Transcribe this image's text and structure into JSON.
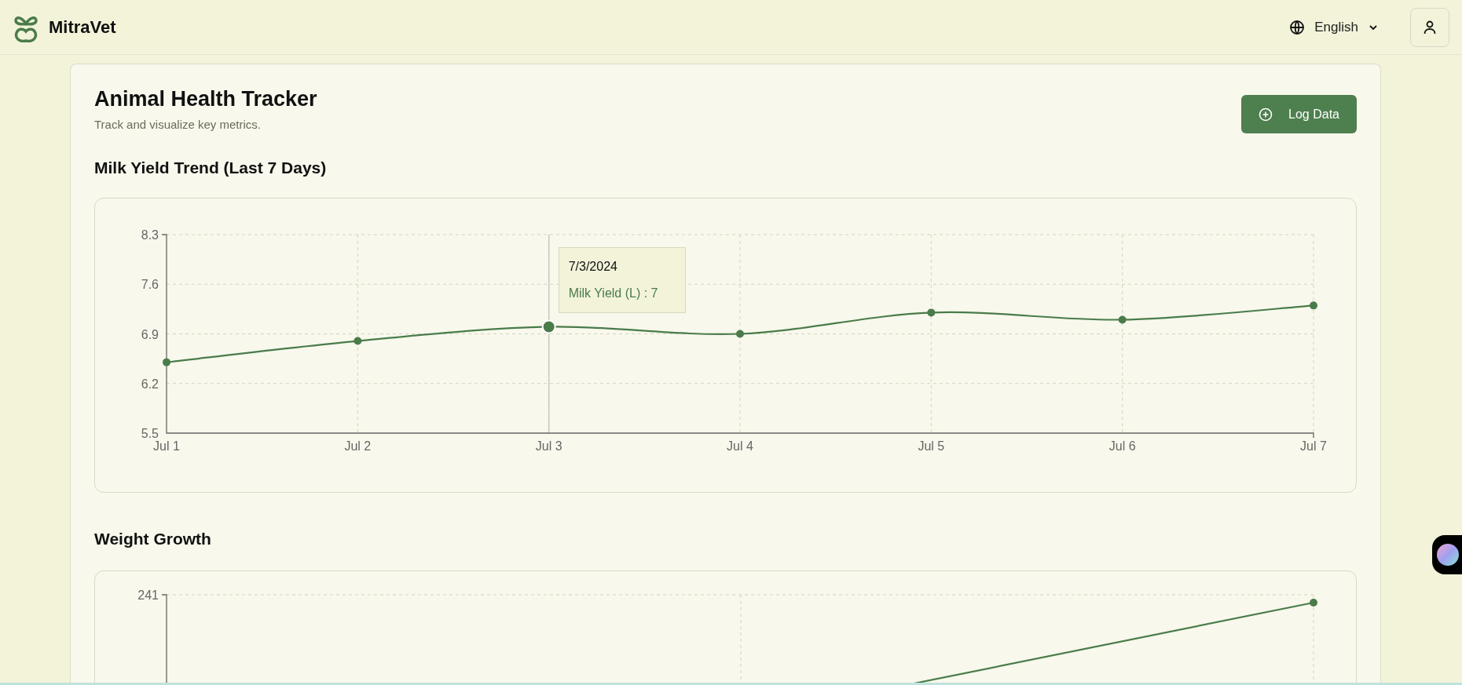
{
  "header": {
    "brand": "MitraVet",
    "language": "English"
  },
  "page": {
    "title": "Animal Health Tracker",
    "subtitle": "Track and visualize key metrics.",
    "action": "Log Data"
  },
  "milk_chart": {
    "title": "Milk Yield Trend (Last 7 Days)",
    "chart_data": {
      "type": "line",
      "categories": [
        "Jul 1",
        "Jul 2",
        "Jul 3",
        "Jul 4",
        "Jul 5",
        "Jul 6",
        "Jul 7"
      ],
      "series": [
        {
          "name": "Milk Yield (L)",
          "color": "#4a7c4a",
          "marker": "o",
          "values": [
            6.5,
            6.8,
            7.0,
            6.9,
            7.2,
            7.1,
            7.3
          ]
        }
      ],
      "ylim": [
        5.5,
        8.3
      ],
      "yticks": [
        5.5,
        6.2,
        6.9,
        7.6,
        8.3
      ],
      "grid": true,
      "ref_lines": [
        {
          "axis": "x",
          "value": "Jul 3",
          "color": "#c8c8c0"
        }
      ]
    },
    "points_selected": [
      false,
      false,
      true,
      false,
      false,
      false,
      false
    ],
    "tooltip": {
      "title": "7/3/2024",
      "separator": " : ",
      "value": "7"
    }
  },
  "weight_chart": {
    "title": "Weight Growth",
    "y_tick_label": "241"
  }
}
